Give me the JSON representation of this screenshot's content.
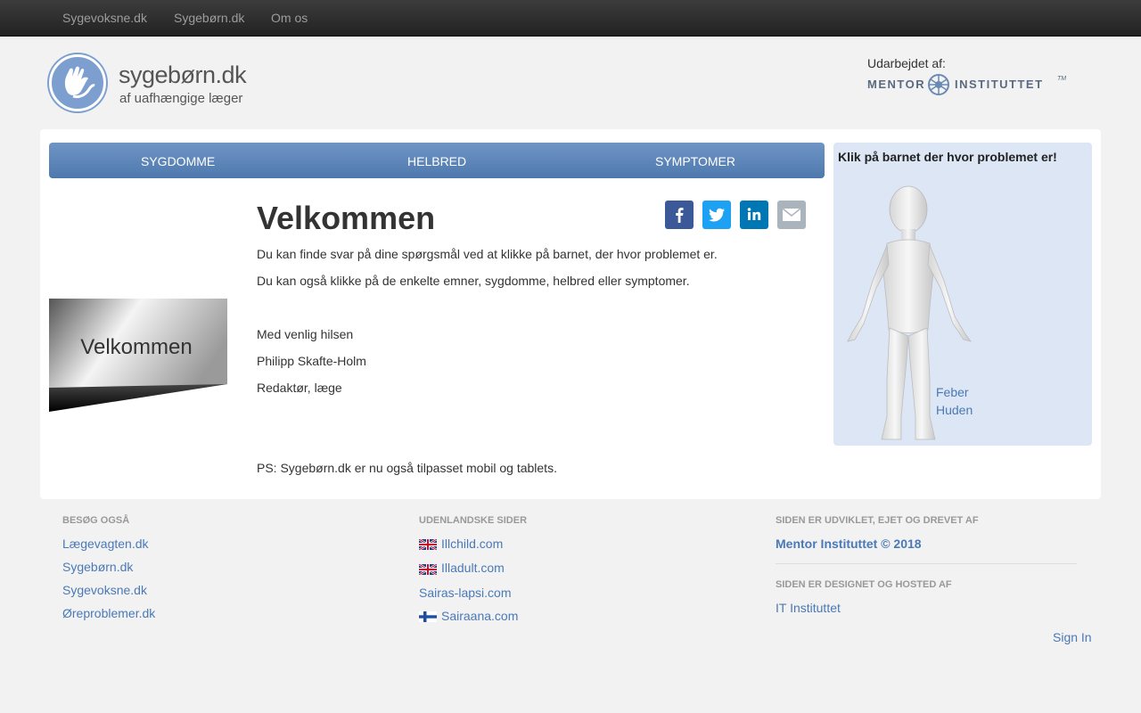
{
  "topnav": [
    "Sygevoksne.dk",
    "Sygebørn.dk",
    "Om os"
  ],
  "header": {
    "logo_title": "sygebørn.dk",
    "logo_subtitle": "af uafhængige læger",
    "udarbejdet": "Udarbejdet af:",
    "mentor_left": "MENTOR",
    "mentor_right": "INSTITUTTET",
    "mentor_tm": "TM"
  },
  "tabs": [
    "SYGDOMME",
    "HELBRED",
    "SYMPTOMER"
  ],
  "welcome_image_text": "Velkommen",
  "content": {
    "heading": "Velkommen",
    "p1": "Du kan finde svar på dine spørgsmål ved at klikke på barnet, der hvor problemet er.",
    "p2": "Du kan også klikke på de enkelte emner, sygdomme, helbred eller symptomer.",
    "greeting": "Med venlig hilsen",
    "name": "Philipp Skafte-Holm",
    "title": "Redaktør, læge",
    "ps": "PS: Sygebørn.dk er nu også tilpasset mobil og tablets."
  },
  "share": [
    {
      "name": "facebook",
      "color": "#3b5998"
    },
    {
      "name": "twitter",
      "color": "#1da1f2"
    },
    {
      "name": "linkedin",
      "color": "#0077b5"
    },
    {
      "name": "email",
      "color": "#aab4bd"
    }
  ],
  "bodybox": {
    "title": "Klik på barnet der hvor problemet er!",
    "links": [
      "Feber",
      "Huden"
    ]
  },
  "footer": {
    "col1_title": "BESØG OGSÅ",
    "col1_links": [
      "Lægevagten.dk",
      "Sygebørn.dk",
      "Sygevoksne.dk",
      "Øreproblemer.dk"
    ],
    "col2_title": "UDENLANDSKE SIDER",
    "col2_links": [
      "Illchild.com",
      "Illadult.com",
      "Sairas-lapsi.com",
      "Sairaana.com"
    ],
    "col3_title1": "SIDEN ER UDVIKLET, EJET OG DREVET AF",
    "col3_link1": "Mentor Instituttet © 2018",
    "col3_title2": "SIDEN ER DESIGNET OG HOSTED AF",
    "col3_link2": "IT Instituttet",
    "sign_in": "Sign In"
  }
}
